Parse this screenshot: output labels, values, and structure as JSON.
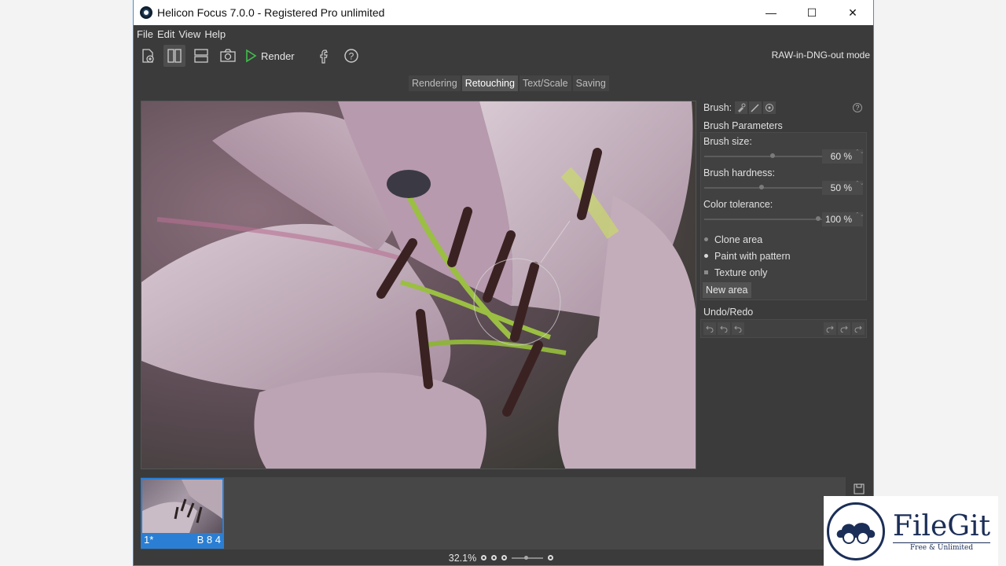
{
  "window": {
    "title": "Helicon Focus 7.0.0 - Registered Pro unlimited",
    "controls": {
      "minimize": "—",
      "maximize": "☐",
      "close": "✕"
    }
  },
  "menu": [
    "File",
    "Edit",
    "View",
    "Help"
  ],
  "toolbar": {
    "render_label": "Render",
    "mode_text": "RAW-in-DNG-out mode",
    "icons": [
      "add-file-icon",
      "vertical-split-icon",
      "horizontal-split-icon",
      "camera-icon",
      "play-icon",
      "facebook-icon",
      "help-icon"
    ]
  },
  "tabs": [
    {
      "label": "Rendering",
      "active": false
    },
    {
      "label": "Retouching",
      "active": true
    },
    {
      "label": "Text/Scale",
      "active": false
    },
    {
      "label": "Saving",
      "active": false
    }
  ],
  "panel": {
    "brush_label": "Brush:",
    "help_glyph": "?",
    "params_title": "Brush Parameters",
    "sliders": [
      {
        "label": "Brush size:",
        "value": "60 %",
        "fraction": 0.6
      },
      {
        "label": "Brush hardness:",
        "value": "50 %",
        "fraction": 0.5
      },
      {
        "label": "Color tolerance:",
        "value": "100 %",
        "fraction": 1.0
      }
    ],
    "options": [
      {
        "label": "Clone area",
        "selected": false
      },
      {
        "label": "Paint with pattern",
        "selected": true
      },
      {
        "label": "Texture only",
        "selected": false
      }
    ],
    "new_area_label": "New area",
    "undo_title": "Undo/Redo"
  },
  "filmstrip": {
    "thumb_index": "1*",
    "thumb_info": "B 8 4"
  },
  "status": {
    "zoom": "32.1%"
  },
  "watermark": {
    "name": "FileGit",
    "tagline": "Free & Unlimited"
  },
  "colors": {
    "accent": "#2a7fd4",
    "panel_bg": "#3b3b3b"
  }
}
